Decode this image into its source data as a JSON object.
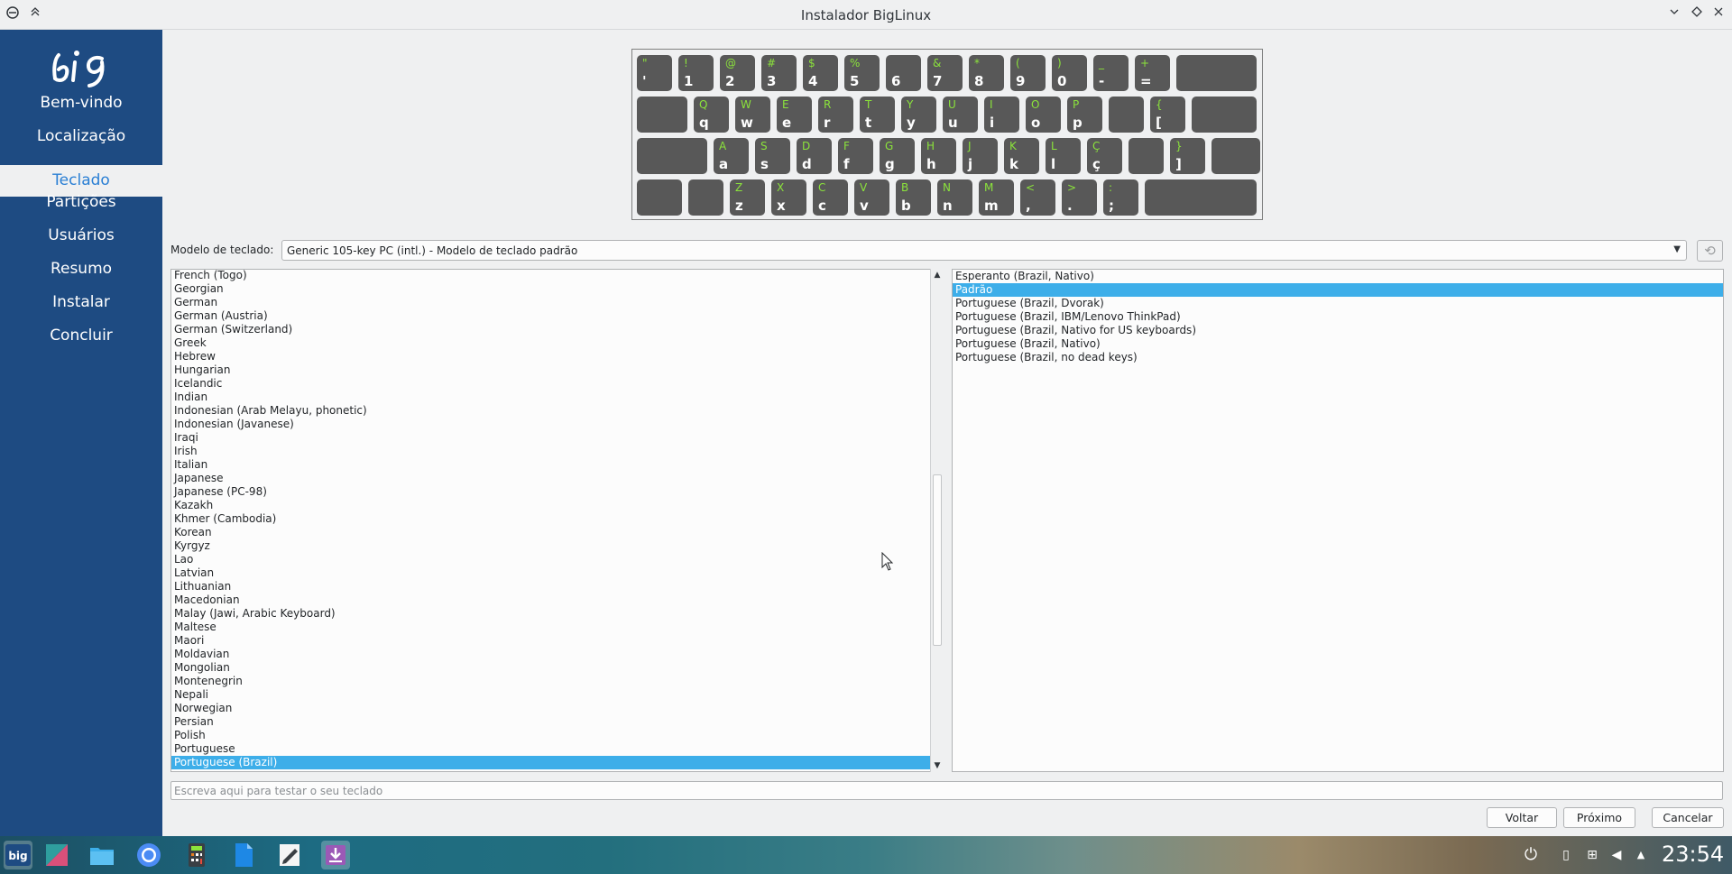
{
  "window": {
    "title": "Instalador BigLinux"
  },
  "sidebar": {
    "items": [
      {
        "label": "Bem-vindo"
      },
      {
        "label": "Localização"
      },
      {
        "label": "Teclado"
      },
      {
        "label": "Partições"
      },
      {
        "label": "Usuários"
      },
      {
        "label": "Resumo"
      },
      {
        "label": "Instalar"
      },
      {
        "label": "Concluir"
      }
    ],
    "active_index": 2
  },
  "keyboard": {
    "rows": [
      [
        [
          "\"",
          "'"
        ],
        [
          "!",
          "1"
        ],
        [
          "@",
          "2"
        ],
        [
          "#",
          "3"
        ],
        [
          "$",
          "4"
        ],
        [
          "%",
          "5"
        ],
        [
          "",
          "6"
        ],
        [
          "&",
          "7"
        ],
        [
          "*",
          "8"
        ],
        [
          "(",
          "9"
        ],
        [
          ")",
          "0"
        ],
        [
          "_",
          "-"
        ],
        [
          "+",
          "="
        ],
        [
          "",
          ""
        ]
      ],
      [
        [
          "",
          ""
        ],
        [
          "Q",
          "q"
        ],
        [
          "W",
          "w"
        ],
        [
          "E",
          "e"
        ],
        [
          "R",
          "r"
        ],
        [
          "T",
          "t"
        ],
        [
          "Y",
          "y"
        ],
        [
          "U",
          "u"
        ],
        [
          "I",
          "i"
        ],
        [
          "O",
          "o"
        ],
        [
          "P",
          "p"
        ],
        [
          "",
          ""
        ],
        [
          "{",
          "["
        ],
        [
          "",
          ""
        ]
      ],
      [
        [
          "",
          ""
        ],
        [
          "A",
          "a"
        ],
        [
          "S",
          "s"
        ],
        [
          "D",
          "d"
        ],
        [
          "F",
          "f"
        ],
        [
          "G",
          "g"
        ],
        [
          "H",
          "h"
        ],
        [
          "J",
          "j"
        ],
        [
          "K",
          "k"
        ],
        [
          "L",
          "l"
        ],
        [
          "Ç",
          "ç"
        ],
        [
          "",
          ""
        ],
        [
          "}",
          "]"
        ],
        [
          "",
          ""
        ]
      ],
      [
        [
          "",
          ""
        ],
        [
          "",
          ""
        ],
        [
          "Z",
          "z"
        ],
        [
          "X",
          "x"
        ],
        [
          "C",
          "c"
        ],
        [
          "V",
          "v"
        ],
        [
          "B",
          "b"
        ],
        [
          "N",
          "n"
        ],
        [
          "M",
          "m"
        ],
        [
          "<",
          ","
        ],
        [
          ">",
          "."
        ],
        [
          ":",
          ";"
        ],
        [
          "",
          ""
        ]
      ]
    ]
  },
  "model": {
    "label": "Modelo de teclado:",
    "value": "Generic 105-key PC (intl.)  -  Modelo de teclado padrão"
  },
  "layouts": [
    "French (Togo)",
    "Georgian",
    "German",
    "German (Austria)",
    "German (Switzerland)",
    "Greek",
    "Hebrew",
    "Hungarian",
    "Icelandic",
    "Indian",
    "Indonesian (Arab Melayu, phonetic)",
    "Indonesian (Javanese)",
    "Iraqi",
    "Irish",
    "Italian",
    "Japanese",
    "Japanese (PC-98)",
    "Kazakh",
    "Khmer (Cambodia)",
    "Korean",
    "Kyrgyz",
    "Lao",
    "Latvian",
    "Lithuanian",
    "Macedonian",
    "Malay (Jawi, Arabic Keyboard)",
    "Maltese",
    "Maori",
    "Moldavian",
    "Mongolian",
    "Montenegrin",
    "Nepali",
    "Norwegian",
    "Persian",
    "Polish",
    "Portuguese",
    "Portuguese (Brazil)"
  ],
  "layout_selected": "Portuguese (Brazil)",
  "variants": [
    "Esperanto (Brazil, Nativo)",
    "Padrão",
    "Portuguese (Brazil, Dvorak)",
    "Portuguese (Brazil, IBM/Lenovo ThinkPad)",
    "Portuguese (Brazil, Nativo for US keyboards)",
    "Portuguese (Brazil, Nativo)",
    "Portuguese (Brazil, no dead keys)"
  ],
  "variant_selected": "Padrão",
  "test": {
    "placeholder": "Escreva aqui para testar o seu teclado"
  },
  "buttons": {
    "back": "Voltar",
    "next": "Próximo",
    "cancel": "Cancelar"
  },
  "taskbar": {
    "apps": [
      "big-menu-icon",
      "kate-icon",
      "files-icon",
      "chromium-icon",
      "calculator-icon",
      "document-icon",
      "text-editor-icon",
      "installer-icon"
    ],
    "clock": "23:54"
  },
  "colors": {
    "sidebar": "#1e4b82",
    "accent": "#3daee9",
    "key": "#585858",
    "shift_label": "#8be33b"
  }
}
